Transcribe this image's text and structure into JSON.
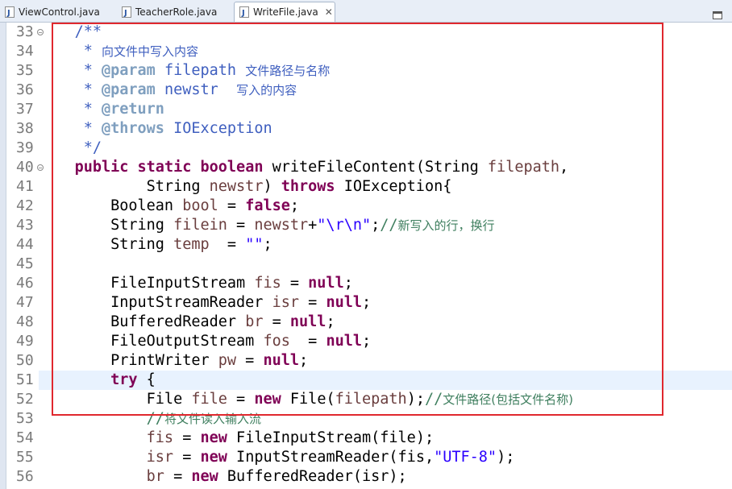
{
  "tabs": [
    {
      "label": "ViewControl.java",
      "active": false
    },
    {
      "label": "TeacherRole.java",
      "active": false
    },
    {
      "label": "WriteFile.java",
      "active": true,
      "close": "✕"
    }
  ],
  "colors": {
    "keyword": "#7f0055",
    "comment": "#3f7f5f",
    "javadoc": "#3f5fbf",
    "javadoc_tag": "#7f9fbf",
    "string": "#2a00ff",
    "variable": "#6a3e3e",
    "highlight_line": "#e8f2fe",
    "selection_box": "#e0282e"
  },
  "editor": {
    "highlighted_line": "51",
    "lines": [
      {
        "num": "33",
        "fold": "−",
        "tokens": [
          {
            "t": "    "
          },
          {
            "t": "/**",
            "c": "jd"
          }
        ]
      },
      {
        "num": "34",
        "tokens": [
          {
            "t": "     "
          },
          {
            "t": "* ",
            "c": "jd"
          },
          {
            "t": "向文件中写入内容",
            "c": "jd cjk"
          }
        ]
      },
      {
        "num": "35",
        "tokens": [
          {
            "t": "     "
          },
          {
            "t": "* ",
            "c": "jd"
          },
          {
            "t": "@param",
            "c": "tag"
          },
          {
            "t": " "
          },
          {
            "t": "filepath",
            "c": "tagv"
          },
          {
            "t": " "
          },
          {
            "t": "文件路径与名称",
            "c": "jd cjk"
          }
        ]
      },
      {
        "num": "36",
        "tokens": [
          {
            "t": "     "
          },
          {
            "t": "* ",
            "c": "jd"
          },
          {
            "t": "@param",
            "c": "tag"
          },
          {
            "t": " "
          },
          {
            "t": "newstr",
            "c": "tagv"
          },
          {
            "t": "  "
          },
          {
            "t": "写入的内容",
            "c": "jd cjk"
          }
        ]
      },
      {
        "num": "37",
        "tokens": [
          {
            "t": "     "
          },
          {
            "t": "* ",
            "c": "jd"
          },
          {
            "t": "@return",
            "c": "tag"
          }
        ]
      },
      {
        "num": "38",
        "tokens": [
          {
            "t": "     "
          },
          {
            "t": "* ",
            "c": "jd"
          },
          {
            "t": "@throws",
            "c": "tag"
          },
          {
            "t": " "
          },
          {
            "t": "IOException",
            "c": "jd"
          }
        ]
      },
      {
        "num": "39",
        "tokens": [
          {
            "t": "     "
          },
          {
            "t": "*/",
            "c": "jd"
          }
        ]
      },
      {
        "num": "40",
        "fold": "−",
        "tokens": [
          {
            "t": "    "
          },
          {
            "t": "public",
            "c": "kw"
          },
          {
            "t": " "
          },
          {
            "t": "static",
            "c": "kw"
          },
          {
            "t": " "
          },
          {
            "t": "boolean",
            "c": "kw"
          },
          {
            "t": " writeFileContent(String "
          },
          {
            "t": "filepath",
            "c": "var"
          },
          {
            "t": ","
          }
        ]
      },
      {
        "num": "41",
        "tokens": [
          {
            "t": "            String "
          },
          {
            "t": "newstr",
            "c": "var"
          },
          {
            "t": ") "
          },
          {
            "t": "throws",
            "c": "kw"
          },
          {
            "t": " IOException{"
          }
        ]
      },
      {
        "num": "42",
        "tokens": [
          {
            "t": "        Boolean "
          },
          {
            "t": "bool",
            "c": "var"
          },
          {
            "t": " = "
          },
          {
            "t": "false",
            "c": "kw"
          },
          {
            "t": ";"
          }
        ]
      },
      {
        "num": "43",
        "tokens": [
          {
            "t": "        String "
          },
          {
            "t": "filein",
            "c": "var"
          },
          {
            "t": " = "
          },
          {
            "t": "newstr",
            "c": "var"
          },
          {
            "t": "+"
          },
          {
            "t": "\"\\r\\n\"",
            "c": "str"
          },
          {
            "t": ";"
          },
          {
            "t": "//",
            "c": "cm"
          },
          {
            "t": "新写入的行，换行",
            "c": "cm cjk"
          }
        ]
      },
      {
        "num": "44",
        "tokens": [
          {
            "t": "        String "
          },
          {
            "t": "temp",
            "c": "var"
          },
          {
            "t": "  = "
          },
          {
            "t": "\"\"",
            "c": "str"
          },
          {
            "t": ";"
          }
        ]
      },
      {
        "num": "45",
        "tokens": [
          {
            "t": ""
          }
        ]
      },
      {
        "num": "46",
        "tokens": [
          {
            "t": "        FileInputStream "
          },
          {
            "t": "fis",
            "c": "var"
          },
          {
            "t": " = "
          },
          {
            "t": "null",
            "c": "kw"
          },
          {
            "t": ";"
          }
        ]
      },
      {
        "num": "47",
        "tokens": [
          {
            "t": "        InputStreamReader "
          },
          {
            "t": "isr",
            "c": "var"
          },
          {
            "t": " = "
          },
          {
            "t": "null",
            "c": "kw"
          },
          {
            "t": ";"
          }
        ]
      },
      {
        "num": "48",
        "tokens": [
          {
            "t": "        BufferedReader "
          },
          {
            "t": "br",
            "c": "var"
          },
          {
            "t": " = "
          },
          {
            "t": "null",
            "c": "kw"
          },
          {
            "t": ";"
          }
        ]
      },
      {
        "num": "49",
        "tokens": [
          {
            "t": "        FileOutputStream "
          },
          {
            "t": "fos",
            "c": "var"
          },
          {
            "t": "  = "
          },
          {
            "t": "null",
            "c": "kw"
          },
          {
            "t": ";"
          }
        ]
      },
      {
        "num": "50",
        "tokens": [
          {
            "t": "        PrintWriter "
          },
          {
            "t": "pw",
            "c": "var"
          },
          {
            "t": " = "
          },
          {
            "t": "null",
            "c": "kw"
          },
          {
            "t": ";"
          }
        ]
      },
      {
        "num": "51",
        "tokens": [
          {
            "t": "        "
          },
          {
            "t": "try",
            "c": "kw"
          },
          {
            "t": " {"
          }
        ]
      },
      {
        "num": "52",
        "tokens": [
          {
            "t": "            File "
          },
          {
            "t": "file",
            "c": "var"
          },
          {
            "t": " = "
          },
          {
            "t": "new",
            "c": "kw"
          },
          {
            "t": " File("
          },
          {
            "t": "filepath",
            "c": "var"
          },
          {
            "t": ");"
          },
          {
            "t": "//",
            "c": "cm"
          },
          {
            "t": "文件路径(包括文件名称)",
            "c": "cm cjk"
          }
        ]
      },
      {
        "num": "53",
        "tokens": [
          {
            "t": "            "
          },
          {
            "t": "//",
            "c": "cm"
          },
          {
            "t": "将文件读入输入流",
            "c": "cm cjk"
          }
        ]
      },
      {
        "num": "54",
        "tokens": [
          {
            "t": "            "
          },
          {
            "t": "fis",
            "c": "var"
          },
          {
            "t": " = "
          },
          {
            "t": "new",
            "c": "kw"
          },
          {
            "t": " FileInputStream(file);"
          }
        ]
      },
      {
        "num": "55",
        "tokens": [
          {
            "t": "            "
          },
          {
            "t": "isr",
            "c": "var"
          },
          {
            "t": " = "
          },
          {
            "t": "new",
            "c": "kw"
          },
          {
            "t": " InputStreamReader(fis,"
          },
          {
            "t": "\"UTF-8\"",
            "c": "str"
          },
          {
            "t": ");"
          }
        ]
      },
      {
        "num": "56",
        "tokens": [
          {
            "t": "            "
          },
          {
            "t": "br",
            "c": "var"
          },
          {
            "t": " = "
          },
          {
            "t": "new",
            "c": "kw"
          },
          {
            "t": " BufferedReader(isr);"
          }
        ]
      }
    ]
  }
}
